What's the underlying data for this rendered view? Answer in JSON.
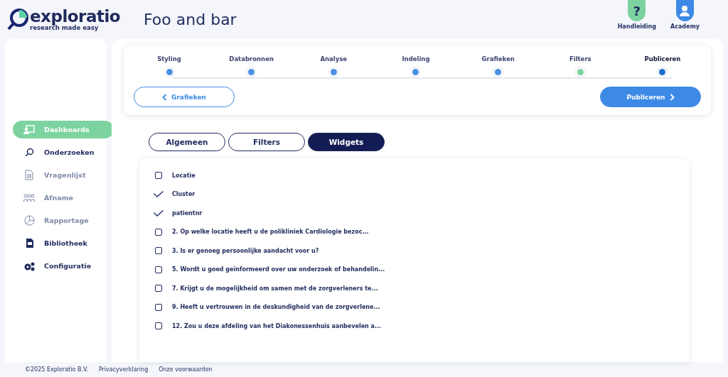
{
  "header": {
    "logo": {
      "name": "exploratio",
      "tagline": "research made easy"
    },
    "title": "Foo and bar",
    "actions": [
      {
        "kind": "help",
        "label": "Handleiding",
        "icon": "?"
      },
      {
        "kind": "user",
        "label": "Academy"
      }
    ]
  },
  "sidebar": {
    "items": [
      {
        "kind": "dashboard",
        "label": "Dashboards",
        "selected": true,
        "disabled": false
      },
      {
        "kind": "search",
        "label": "Onderzoeken",
        "selected": false,
        "disabled": false
      },
      {
        "kind": "document",
        "label": "Vragenlijst",
        "selected": false,
        "disabled": true
      },
      {
        "kind": "people",
        "label": "Afname",
        "selected": false,
        "disabled": true
      },
      {
        "kind": "pie",
        "label": "Rapportage",
        "selected": false,
        "disabled": true
      },
      {
        "kind": "library",
        "label": "Bibliotheek",
        "selected": false,
        "disabled": false
      },
      {
        "kind": "gears",
        "label": "Configuratie",
        "selected": false,
        "disabled": false
      }
    ]
  },
  "stepper": {
    "steps": [
      {
        "label": "Styling",
        "selected": false,
        "color": "#4a90e2"
      },
      {
        "label": "Databronnen",
        "selected": false,
        "color": "#4a90e2"
      },
      {
        "label": "Analyse",
        "selected": false,
        "color": "#4a90e2"
      },
      {
        "label": "Indeling",
        "selected": false,
        "color": "#4a90e2"
      },
      {
        "label": "Grafieken",
        "selected": false,
        "color": "#4a90e2"
      },
      {
        "label": "Filters",
        "selected": false,
        "color": "#7dd3a0"
      },
      {
        "label": "Publiceren",
        "selected": true,
        "color": "#1e6fd0"
      }
    ],
    "back_button": "Grafieken",
    "next_button": "Publiceren"
  },
  "tabs": [
    {
      "label": "Algemeen",
      "selected": false
    },
    {
      "label": "Filters",
      "selected": false
    },
    {
      "label": "Widgets",
      "selected": true
    }
  ],
  "widgets": [
    {
      "label": "Locatie",
      "checked": false
    },
    {
      "label": "Cluster",
      "checked": true
    },
    {
      "label": "patientnr",
      "checked": true
    },
    {
      "label": "2. Op welke locatie heeft u de polikliniek Cardiologie bezoc...",
      "checked": false
    },
    {
      "label": "3. Is er genoeg persoonlijke aandacht voor u?",
      "checked": false
    },
    {
      "label": "5. Wordt u goed geïnformeerd over uw onderzoek of behandelin...",
      "checked": false
    },
    {
      "label": "7. Krijgt u de mogelijkheid om samen met de zorgverleners te...",
      "checked": false
    },
    {
      "label": "9. Heeft u vertrouwen in de deskundigheid van de zorgverlene...",
      "checked": false
    },
    {
      "label": "12. Zou u deze afdeling van het Diakonessenhuis aanbevelen a...",
      "checked": false
    }
  ],
  "footer": {
    "copyright": "©2025 Exploratio B.V.",
    "links": [
      "Privacyverklaring",
      "Onze voorwaarden"
    ]
  }
}
